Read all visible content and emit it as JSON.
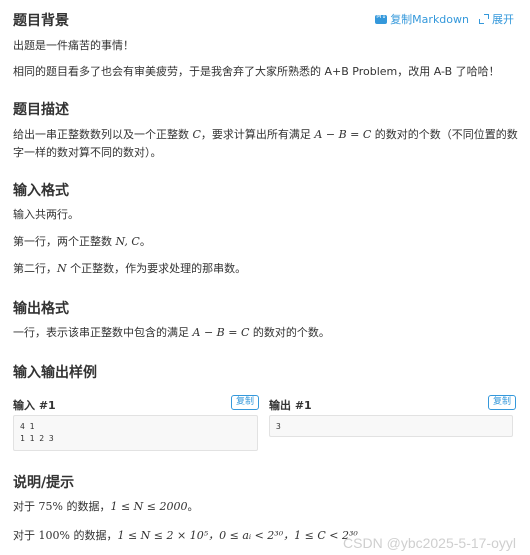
{
  "toolbar": {
    "copy_markdown": "复制Markdown",
    "expand": "展开"
  },
  "background": {
    "title": "题目背景",
    "p1": "出题是一件痛苦的事情！",
    "p2": "相同的题目看多了也会有审美疲劳，于是我舍弃了大家所熟悉的 A+B Problem，改用 A-B 了哈哈！"
  },
  "description": {
    "title": "题目描述",
    "line1_a": "给出一串正整数数列以及一个正整数 ",
    "line1_c": "C",
    "line1_b": "，要求计算出所有满足 ",
    "line1_formula": "A − B = C",
    "line1_d": " 的数对的个数（不同位置的数",
    "line2": "字一样的数对算不同的数对）。"
  },
  "input_format": {
    "title": "输入格式",
    "p1": "输入共两行。",
    "p2_a": "第一行，两个正整数 ",
    "p2_math": "N, C",
    "p2_b": "。",
    "p3_a": "第二行，",
    "p3_math": "N",
    "p3_b": " 个正整数，作为要求处理的那串数。"
  },
  "output_format": {
    "title": "输出格式",
    "p1_a": "一行，表示该串正整数中包含的满足 ",
    "p1_math": "A − B = C",
    "p1_b": " 的数对的个数。"
  },
  "samples": {
    "title": "输入输出样例",
    "input_label": "输入 #1",
    "output_label": "输出 #1",
    "copy_label": "复制",
    "input_value": "4 1\n1 1 2 3",
    "output_value": "3"
  },
  "hint": {
    "title": "说明/提示",
    "p1_a": "对于 ",
    "p1_pct": "75%",
    "p1_b": " 的数据，",
    "p1_math": "1 ≤ N ≤ 2000",
    "p1_c": "。",
    "p2_a": "对于 ",
    "p2_pct": "100%",
    "p2_b": " 的数据，",
    "p2_math": "1 ≤ N ≤ 2 × 10⁵，0 ≤ aᵢ < 2³⁰，1 ≤ C < 2³⁰"
  },
  "watermark": "CSDN @ybc2025-5-17-oyyl"
}
